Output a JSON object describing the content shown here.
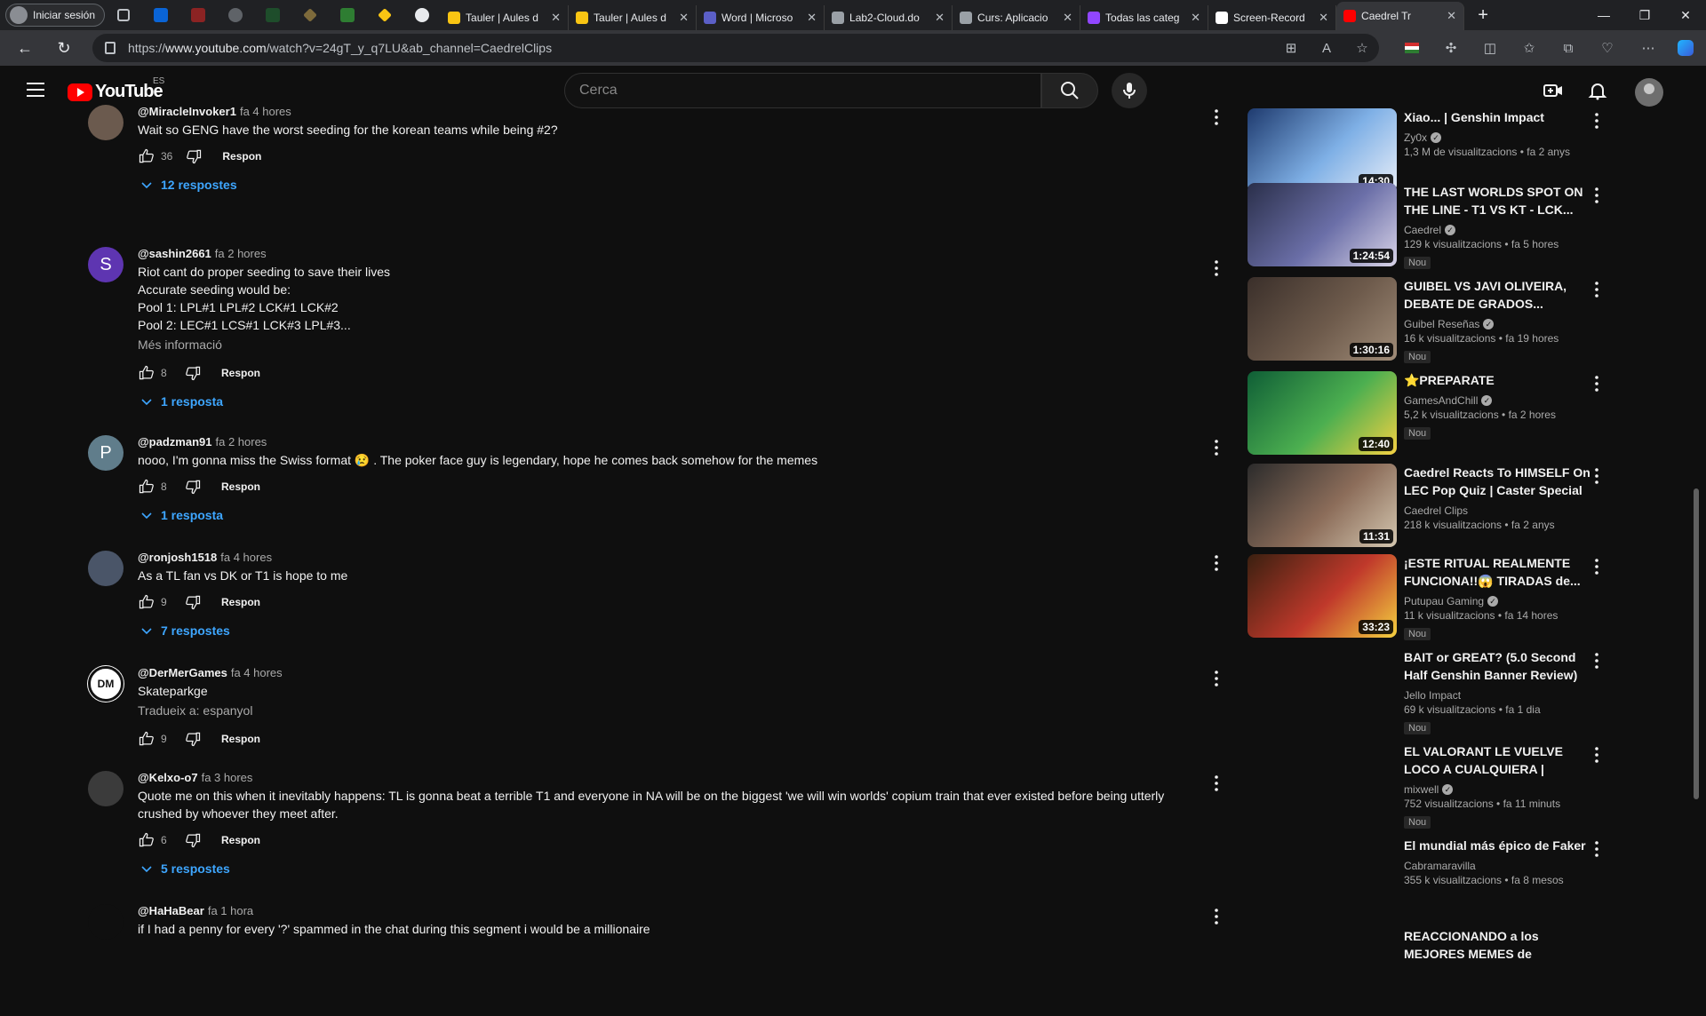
{
  "browser": {
    "profile_label": "Iniciar sesión",
    "tabs": [
      {
        "label": "Tauler | Aules d",
        "color": "#f9c513"
      },
      {
        "label": "Tauler | Aules d",
        "color": "#f9c513"
      },
      {
        "label": "Word | Microso",
        "color": "#5b5fc7"
      },
      {
        "label": "Lab2-Cloud.do",
        "color": "#9aa0a6"
      },
      {
        "label": "Curs: Aplicacio",
        "color": "#9aa0a6"
      },
      {
        "label": "Todas las categ",
        "color": "#9146ff"
      },
      {
        "label": "Screen-Record",
        "color": "#ffffff"
      },
      {
        "label": "Caedrel Tr",
        "color": "#ff0000"
      }
    ],
    "url_prefix": "https://",
    "url_domain": "www.youtube.com",
    "url_path": "/watch?v=24gT_y_q7LU&ab_channel=CaedrelClips"
  },
  "header": {
    "logo_text": "YouTube",
    "country_code": "ES",
    "search_placeholder": "Cerca"
  },
  "comments": [
    {
      "author": "@MiracleInvoker1",
      "time": "fa 4 hores",
      "lines": [
        "Wait so GENG have the worst seeding for the korean teams while being #2?"
      ],
      "likes": "36",
      "reply_label": "Respon",
      "replies": "12 respostes",
      "avatar_color": "#6b5a4e",
      "avatar_letter": ""
    },
    {
      "author": "@sashin2661",
      "time": "fa 2 hores",
      "lines": [
        "Riot cant do proper seeding to save their lives",
        "Accurate seeding would be:",
        "Pool 1: LPL#1 LPL#2 LCK#1 LCK#2",
        "Pool 2: LEC#1 LCS#1 LCK#3 LPL#3..."
      ],
      "more": "Més informació",
      "likes": "8",
      "reply_label": "Respon",
      "replies": "1 resposta",
      "avatar_color": "#5e35b1",
      "avatar_letter": "S"
    },
    {
      "author": "@padzman91",
      "time": "fa 2 hores",
      "lines": [
        "nooo, I'm gonna miss the Swiss format 😢 . The poker face guy is legendary, hope he comes back somehow for the memes"
      ],
      "likes": "8",
      "reply_label": "Respon",
      "replies": "1 resposta",
      "avatar_color": "#607d8b",
      "avatar_letter": "P"
    },
    {
      "author": "@ronjosh1518",
      "time": "fa 4 hores",
      "lines": [
        "As a TL fan vs DK or T1 is hope to me"
      ],
      "likes": "9",
      "reply_label": "Respon",
      "replies": "7 respostes",
      "avatar_color": "#4a5568",
      "avatar_letter": ""
    },
    {
      "author": "@DerMerGames",
      "time": "fa 4 hores",
      "lines": [
        "Skateparkge"
      ],
      "more": "Tradueix a: espanyol",
      "likes": "9",
      "reply_label": "Respon",
      "replies": "",
      "avatar_color": "#ffffff",
      "avatar_letter": "DM"
    },
    {
      "author": "@Kelxo-o7",
      "time": "fa 3 hores",
      "lines": [
        "Quote me on this when it inevitably happens: TL is gonna beat a terrible T1 and everyone in NA will be on the biggest 'we will win worlds' copium train that ever existed before being utterly",
        "crushed by whoever they meet after."
      ],
      "likes": "6",
      "reply_label": "Respon",
      "replies": "5 respostes",
      "avatar_color": "#3b3b3b",
      "avatar_letter": ""
    },
    {
      "author": "@HaHaBear",
      "time": "fa 1 hora",
      "lines": [
        "if I had a penny for every '?' spammed in the chat during this segment i would be a millionaire"
      ],
      "likes": "",
      "reply_label": "",
      "replies": "",
      "avatar_color": "#0f0f0f",
      "avatar_letter": ""
    }
  ],
  "recommendations": [
    {
      "title": "Xiao... | Genshin Impact",
      "channel": "Zy0x",
      "verified": true,
      "stats": "1,3 M de visualitzacions • fa 2 anys",
      "duration": "14:30",
      "new": "",
      "thumb": [
        "#1e3a6e",
        "#7fb0e6",
        "#e8eef8"
      ]
    },
    {
      "title": "THE LAST WORLDS SPOT ON THE LINE - T1 VS KT - LCK...",
      "channel": "Caedrel",
      "verified": true,
      "stats": "129 k visualitzacions • fa 5 hores",
      "duration": "1:24:54",
      "new": "Nou",
      "thumb": [
        "#2a2f4a",
        "#6b6fa8",
        "#d9d4e8"
      ]
    },
    {
      "title": "GUIBEL VS JAVI OLIVEIRA, DEBATE DE GRADOS...",
      "channel": "Guibel Reseñas",
      "verified": true,
      "stats": "16 k visualitzacions • fa 19 hores",
      "duration": "1:30:16",
      "new": "Nou",
      "thumb": [
        "#3a2f2a",
        "#6e5b4c",
        "#a08c78"
      ]
    },
    {
      "title": "⭐PREPARATE",
      "channel": "GamesAndChill",
      "verified": true,
      "stats": "5,2 k visualitzacions • fa 2 hores",
      "duration": "12:40",
      "new": "Nou",
      "thumb": [
        "#0f5e36",
        "#4caf50",
        "#f5d142"
      ]
    },
    {
      "title": "Caedrel Reacts To HIMSELF On LEC Pop Quiz | Caster Special",
      "channel": "Caedrel Clips",
      "verified": false,
      "stats": "218 k visualitzacions • fa 2 anys",
      "duration": "11:31",
      "new": "",
      "thumb": [
        "#2b2b2b",
        "#8c6d5a",
        "#d4c7b0"
      ]
    },
    {
      "title": "¡ESTE RITUAL REALMENTE FUNCIONA!!😱 TIRADAS de...",
      "channel": "Putupau Gaming",
      "verified": true,
      "stats": "11 k visualitzacions • fa 14 hores",
      "duration": "33:23",
      "new": "Nou",
      "thumb": [
        "#3a2010",
        "#c0392b",
        "#f4d03f"
      ]
    },
    {
      "title": "BAIT or GREAT? (5.0 Second Half Genshin Banner Review)",
      "channel": "Jello Impact",
      "verified": false,
      "stats": "69 k visualitzacions • fa 1 dia",
      "duration": "",
      "new": "Nou",
      "thumb": null
    },
    {
      "title": "EL VALORANT LE VUELVE LOCO A CUALQUIERA | Heretics...",
      "channel": "mixwell",
      "verified": true,
      "stats": "752 visualitzacions • fa 11 minuts",
      "duration": "",
      "new": "Nou",
      "thumb": null
    },
    {
      "title": "El mundial más épico de Faker",
      "channel": "Cabramaravilla",
      "verified": false,
      "stats": "355 k visualitzacions • fa 8 mesos",
      "duration": "",
      "new": "",
      "thumb": null
    },
    {
      "title": "REACCIONANDO a los MEJORES MEMES de GENSHI...",
      "channel": "",
      "verified": false,
      "stats": "",
      "duration": "",
      "new": "",
      "thumb": null
    }
  ]
}
